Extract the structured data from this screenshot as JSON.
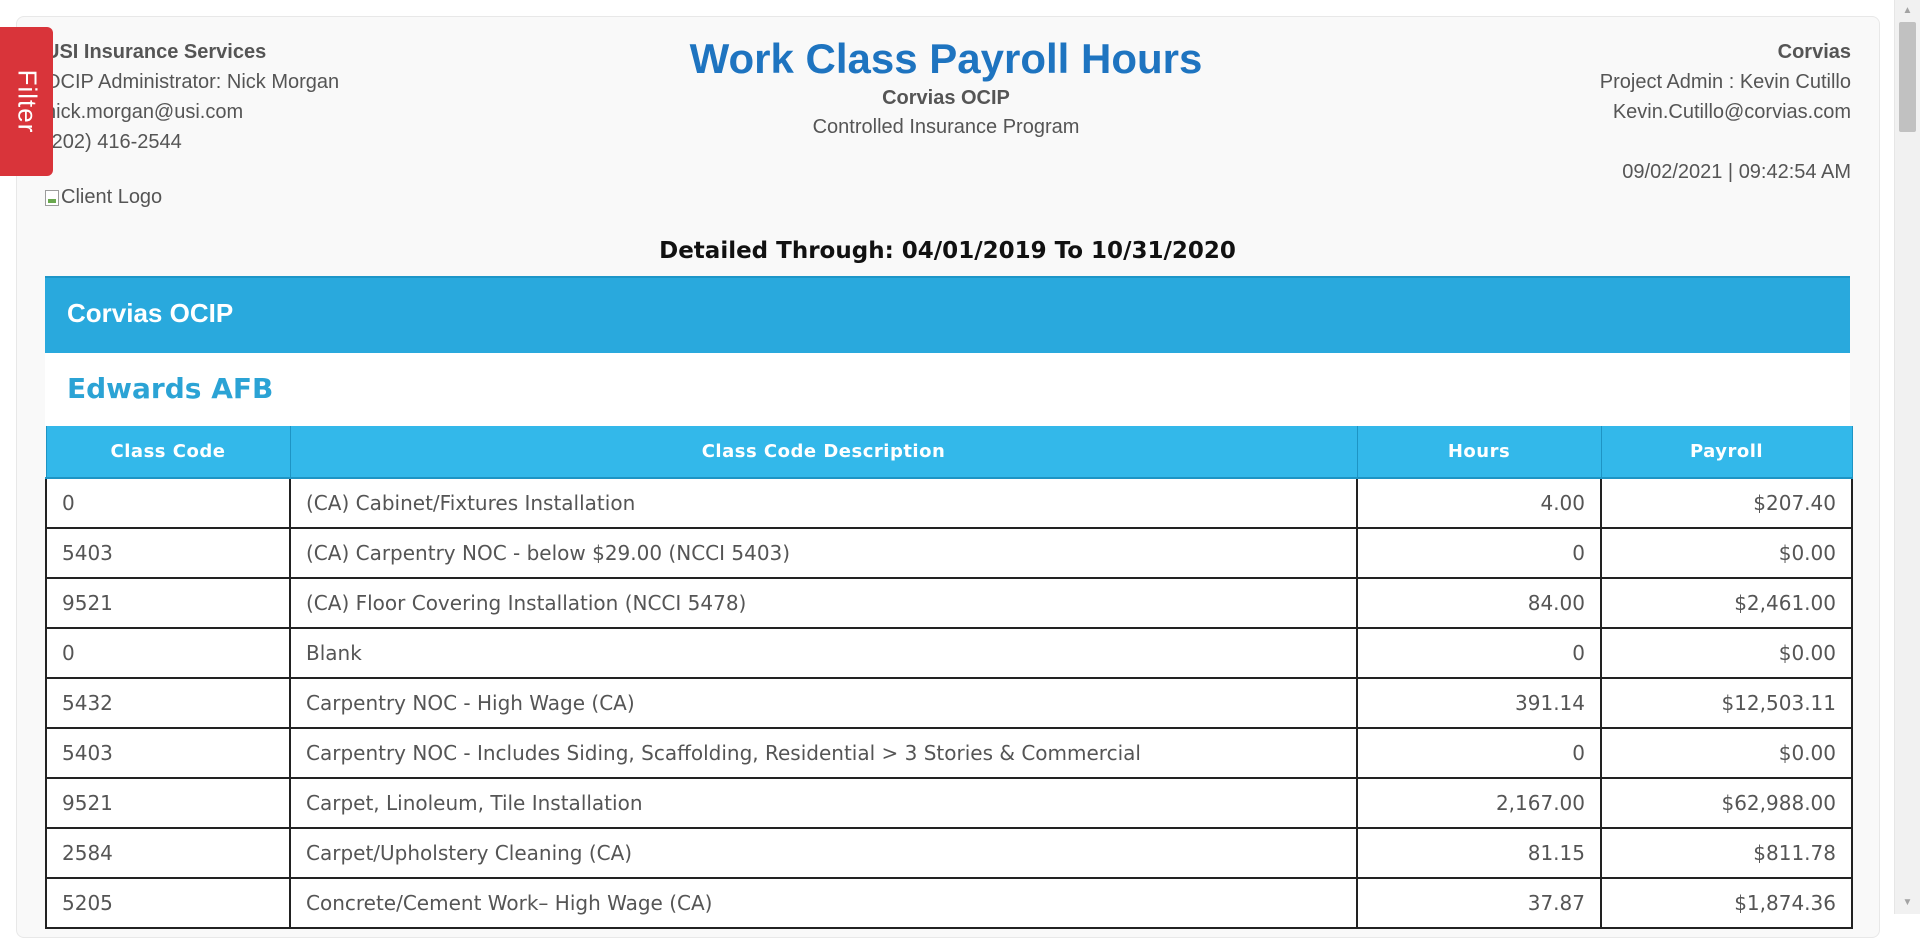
{
  "filter_tab": {
    "label": "Filter"
  },
  "header_left": {
    "org": "USI Insurance Services",
    "administrator": "OCIP Administrator: Nick Morgan",
    "email": "nick.morgan@usi.com",
    "phone": "(202) 416-2544"
  },
  "header_center": {
    "title": "Work Class Payroll Hours",
    "subtitle": "Corvias OCIP",
    "program": "Controlled Insurance Program"
  },
  "header_right": {
    "org": "Corvias",
    "project_admin": "Project Admin : Kevin Cutillo",
    "email": "Kevin.Cutillo@corvias.com",
    "timestamp": "09/02/2021 | 09:42:54 AM"
  },
  "client_logo_alt": "Client Logo",
  "detailed_through": "Detailed Through: 04/01/2019 To 10/31/2020",
  "program_name": "Corvias OCIP",
  "site_name": "Edwards AFB",
  "table": {
    "headers": [
      "Class Code",
      "Class Code Description",
      "Hours",
      "Payroll"
    ],
    "rows": [
      [
        "0",
        "(CA) Cabinet/Fixtures Installation",
        "4.00",
        "$207.40"
      ],
      [
        "5403",
        "(CA) Carpentry NOC - below $29.00 (NCCI 5403)",
        "0",
        "$0.00"
      ],
      [
        "9521",
        "(CA) Floor Covering Installation (NCCI 5478)",
        "84.00",
        "$2,461.00"
      ],
      [
        "0",
        "Blank",
        "0",
        "$0.00"
      ],
      [
        "5432",
        "Carpentry NOC - High Wage (CA)",
        "391.14",
        "$12,503.11"
      ],
      [
        "5403",
        "Carpentry NOC - Includes Siding, Scaffolding, Residential > 3 Stories & Commercial",
        "0",
        "$0.00"
      ],
      [
        "9521",
        "Carpet, Linoleum, Tile Installation",
        "2,167.00",
        "$62,988.00"
      ],
      [
        "2584",
        "Carpet/Upholstery Cleaning (CA)",
        "81.15",
        "$811.78"
      ],
      [
        "5205",
        "Concrete/Cement Work– High Wage (CA)",
        "37.87",
        "$1,874.36"
      ]
    ]
  },
  "colors": {
    "title_blue": "#1e74c0",
    "band_blue": "#29a9dd",
    "header_blue": "#33b8ea",
    "site_blue": "#2ba3d5",
    "filter_red": "#d9343a"
  }
}
